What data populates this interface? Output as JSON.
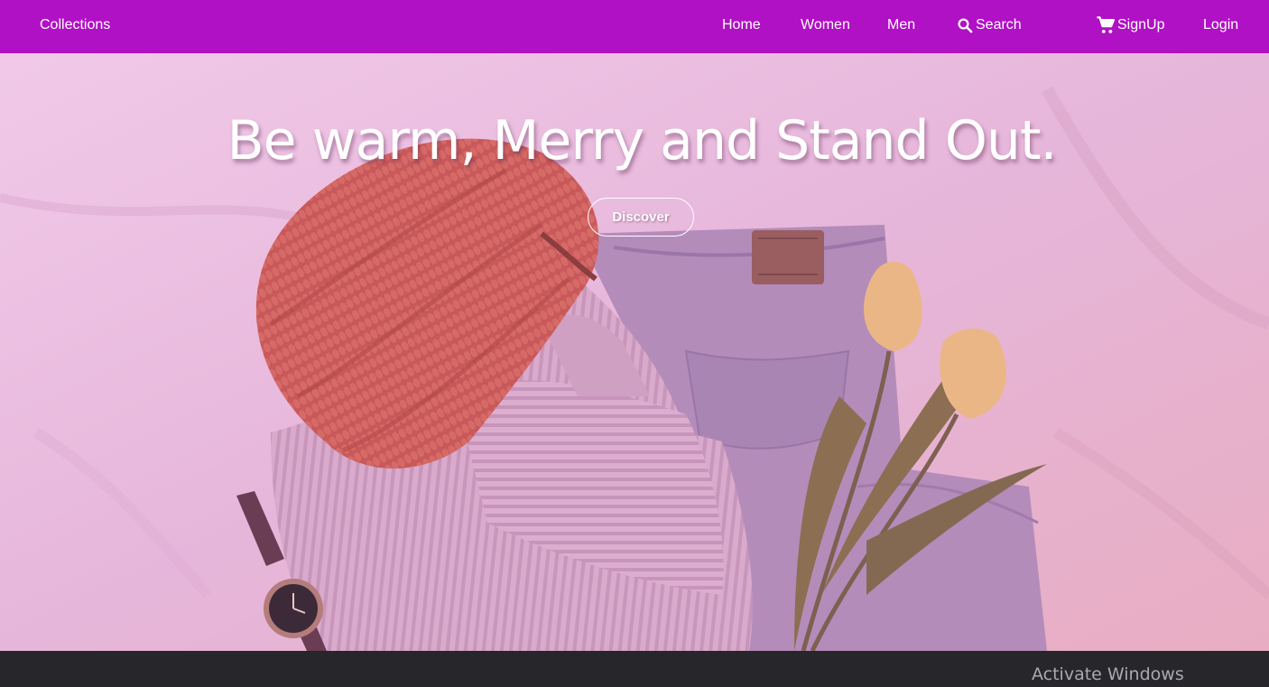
{
  "navbar": {
    "brand": "Collections",
    "links": {
      "home": "Home",
      "women": "Women",
      "men": "Men",
      "search": "Search",
      "signup": "SignUp",
      "login": "Login"
    },
    "icons": {
      "search": "search-icon",
      "cart": "cart-icon"
    },
    "background_color": "#b011c4"
  },
  "hero": {
    "title": "Be warm, Merry and Stand Out.",
    "button_label": "Discover",
    "overlay_color": "#e3b2d8"
  },
  "system": {
    "watermark": "Activate Windows"
  }
}
